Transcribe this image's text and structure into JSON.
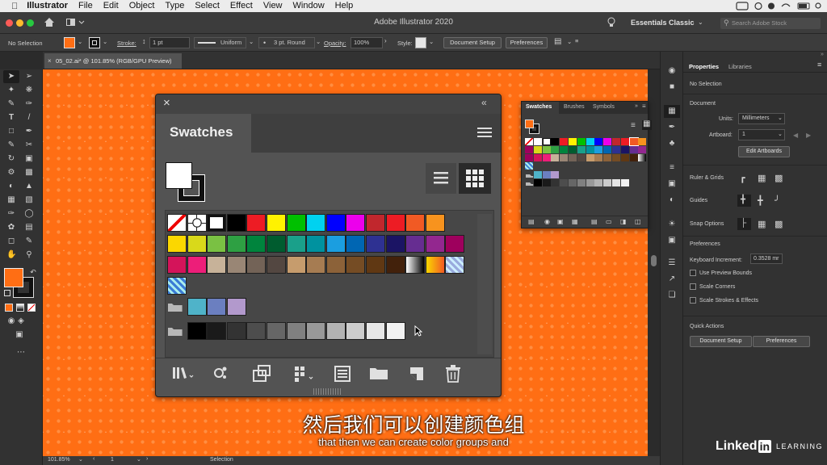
{
  "menubar": {
    "app": "Illustrator",
    "items": [
      "File",
      "Edit",
      "Object",
      "Type",
      "Select",
      "Effect",
      "View",
      "Window",
      "Help"
    ]
  },
  "appbar": {
    "title": "Adobe Illustrator 2020",
    "workspace": "Essentials Classic",
    "search_placeholder": "Search Adobe Stock"
  },
  "control": {
    "selection": "No Selection",
    "stroke_label": "Stroke:",
    "stroke_value": "1 pt",
    "profile": "Uniform",
    "brush": "3 pt. Round",
    "opacity_label": "Opacity:",
    "opacity_value": "100%",
    "style_label": "Style:",
    "doc_setup": "Document Setup",
    "preferences": "Preferences"
  },
  "document": {
    "tab": "05_02.ai* @ 101.85% (RGB/GPU Preview)",
    "zoom": "101.85%",
    "artboard": "1",
    "status": "Selection"
  },
  "swatches_big": {
    "title": "Swatches"
  },
  "swatches_small": {
    "tabs": [
      "Swatches",
      "Brushes",
      "Symbols"
    ]
  },
  "properties": {
    "tabs": [
      "Properties",
      "Libraries"
    ],
    "no_selection": "No Selection",
    "document": "Document",
    "units_label": "Units:",
    "units_value": "Millimeters",
    "artboard_label": "Artboard:",
    "artboard_value": "1",
    "edit_artboards": "Edit Artboards",
    "rulers_grids": "Ruler & Grids",
    "guides": "Guides",
    "snap_options": "Snap Options",
    "preferences": "Preferences",
    "keyboard_increment_label": "Keyboard Increment:",
    "keyboard_increment_value": "0.3528 mr",
    "use_preview_bounds": "Use Preview Bounds",
    "scale_corners": "Scale Corners",
    "scale_strokes": "Scale Strokes & Effects",
    "quick_actions": "Quick Actions",
    "doc_setup_btn": "Document Setup",
    "prefs_btn": "Preferences"
  },
  "subtitles": {
    "cn": "然后我们可以创建颜色组",
    "en": "that then we can create color groups and"
  },
  "watermark": {
    "brand": "Linked",
    "brand_in": "in",
    "learning": "LEARNING"
  },
  "colors": {
    "accent_orange": "#ff6e14",
    "row1": [
      "#000000",
      "#ed1c24",
      "#fff200",
      "#00c000",
      "#00d2f0",
      "#0000ff",
      "#ec00ec",
      "#c1272d",
      "#ed1c24",
      "#f15a24",
      "#f7931e"
    ],
    "row2": [
      "#fbd700",
      "#d9d91a",
      "#7ac143",
      "#2ea043",
      "#00843d",
      "#005c2f",
      "#1aa08a",
      "#00929f",
      "#1b9ee0",
      "#0066b3",
      "#2e3192",
      "#1b1464",
      "#662d91",
      "#93278f",
      "#9e005d"
    ],
    "row3": [
      "#d4145a",
      "#ed1e79",
      "#c7b299",
      "#998675",
      "#736357",
      "#534741",
      "#c69c6d",
      "#a67c52",
      "#8c6239",
      "#754c24",
      "#603813",
      "#42210b"
    ],
    "group1": [
      "#4fb3c9",
      "#6b7fc0",
      "#b299cc"
    ],
    "grays": [
      "#000000",
      "#1a1a1a",
      "#333333",
      "#4d4d4d",
      "#666666",
      "#808080",
      "#999999",
      "#b3b3b3",
      "#cccccc",
      "#e6e6e6",
      "#f2f2f2"
    ]
  }
}
